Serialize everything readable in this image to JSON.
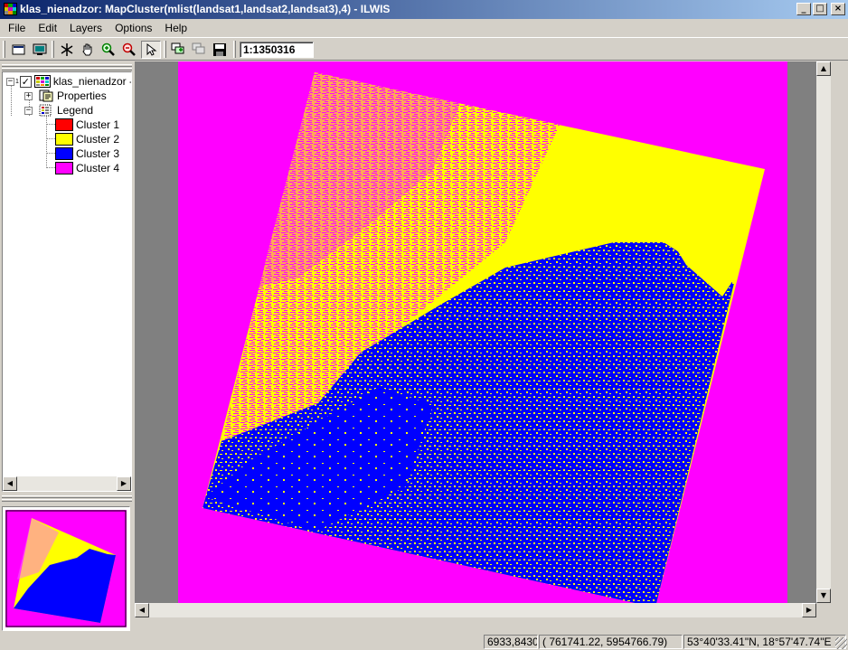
{
  "window": {
    "title": "klas_nienadzor: MapCluster(mlist(landsat1,landsat2,landsat3),4) - ILWIS",
    "minimize_glyph": "_",
    "maximize_glyph": "□",
    "close_glyph": "×"
  },
  "menu": [
    "File",
    "Edit",
    "Layers",
    "Options",
    "Help"
  ],
  "toolbar": {
    "buttons": [
      "new-map-icon",
      "display-icon",
      "normal-icon",
      "pan-hand-icon",
      "zoom-in-icon",
      "zoom-out-icon",
      "select-pointer-icon",
      "add-layer-icon",
      "remove-layer-icon",
      "save-icon"
    ],
    "scale": "1:1350316"
  },
  "layer_tree": {
    "root_label": "klas_nienadzor -",
    "properties_label": "Properties",
    "legend_label": "Legend",
    "clusters": [
      {
        "label": "Cluster 1",
        "color": "#ff0000"
      },
      {
        "label": "Cluster 2",
        "color": "#ffff00"
      },
      {
        "label": "Cluster 3",
        "color": "#0000ff"
      },
      {
        "label": "Cluster 4",
        "color": "#ff00ff"
      }
    ]
  },
  "colors": {
    "background": "#ff00ff",
    "land": "#0000ff",
    "features": "#ffff00",
    "map_gray": "#808080",
    "title_bar": "#0a246a"
  },
  "statusbar": {
    "rowcol": "6933,8430",
    "coords": "(   761741.22,   5954766.79)",
    "latlon": "53°40'33.41\"N, 18°57'47.74\"E"
  }
}
